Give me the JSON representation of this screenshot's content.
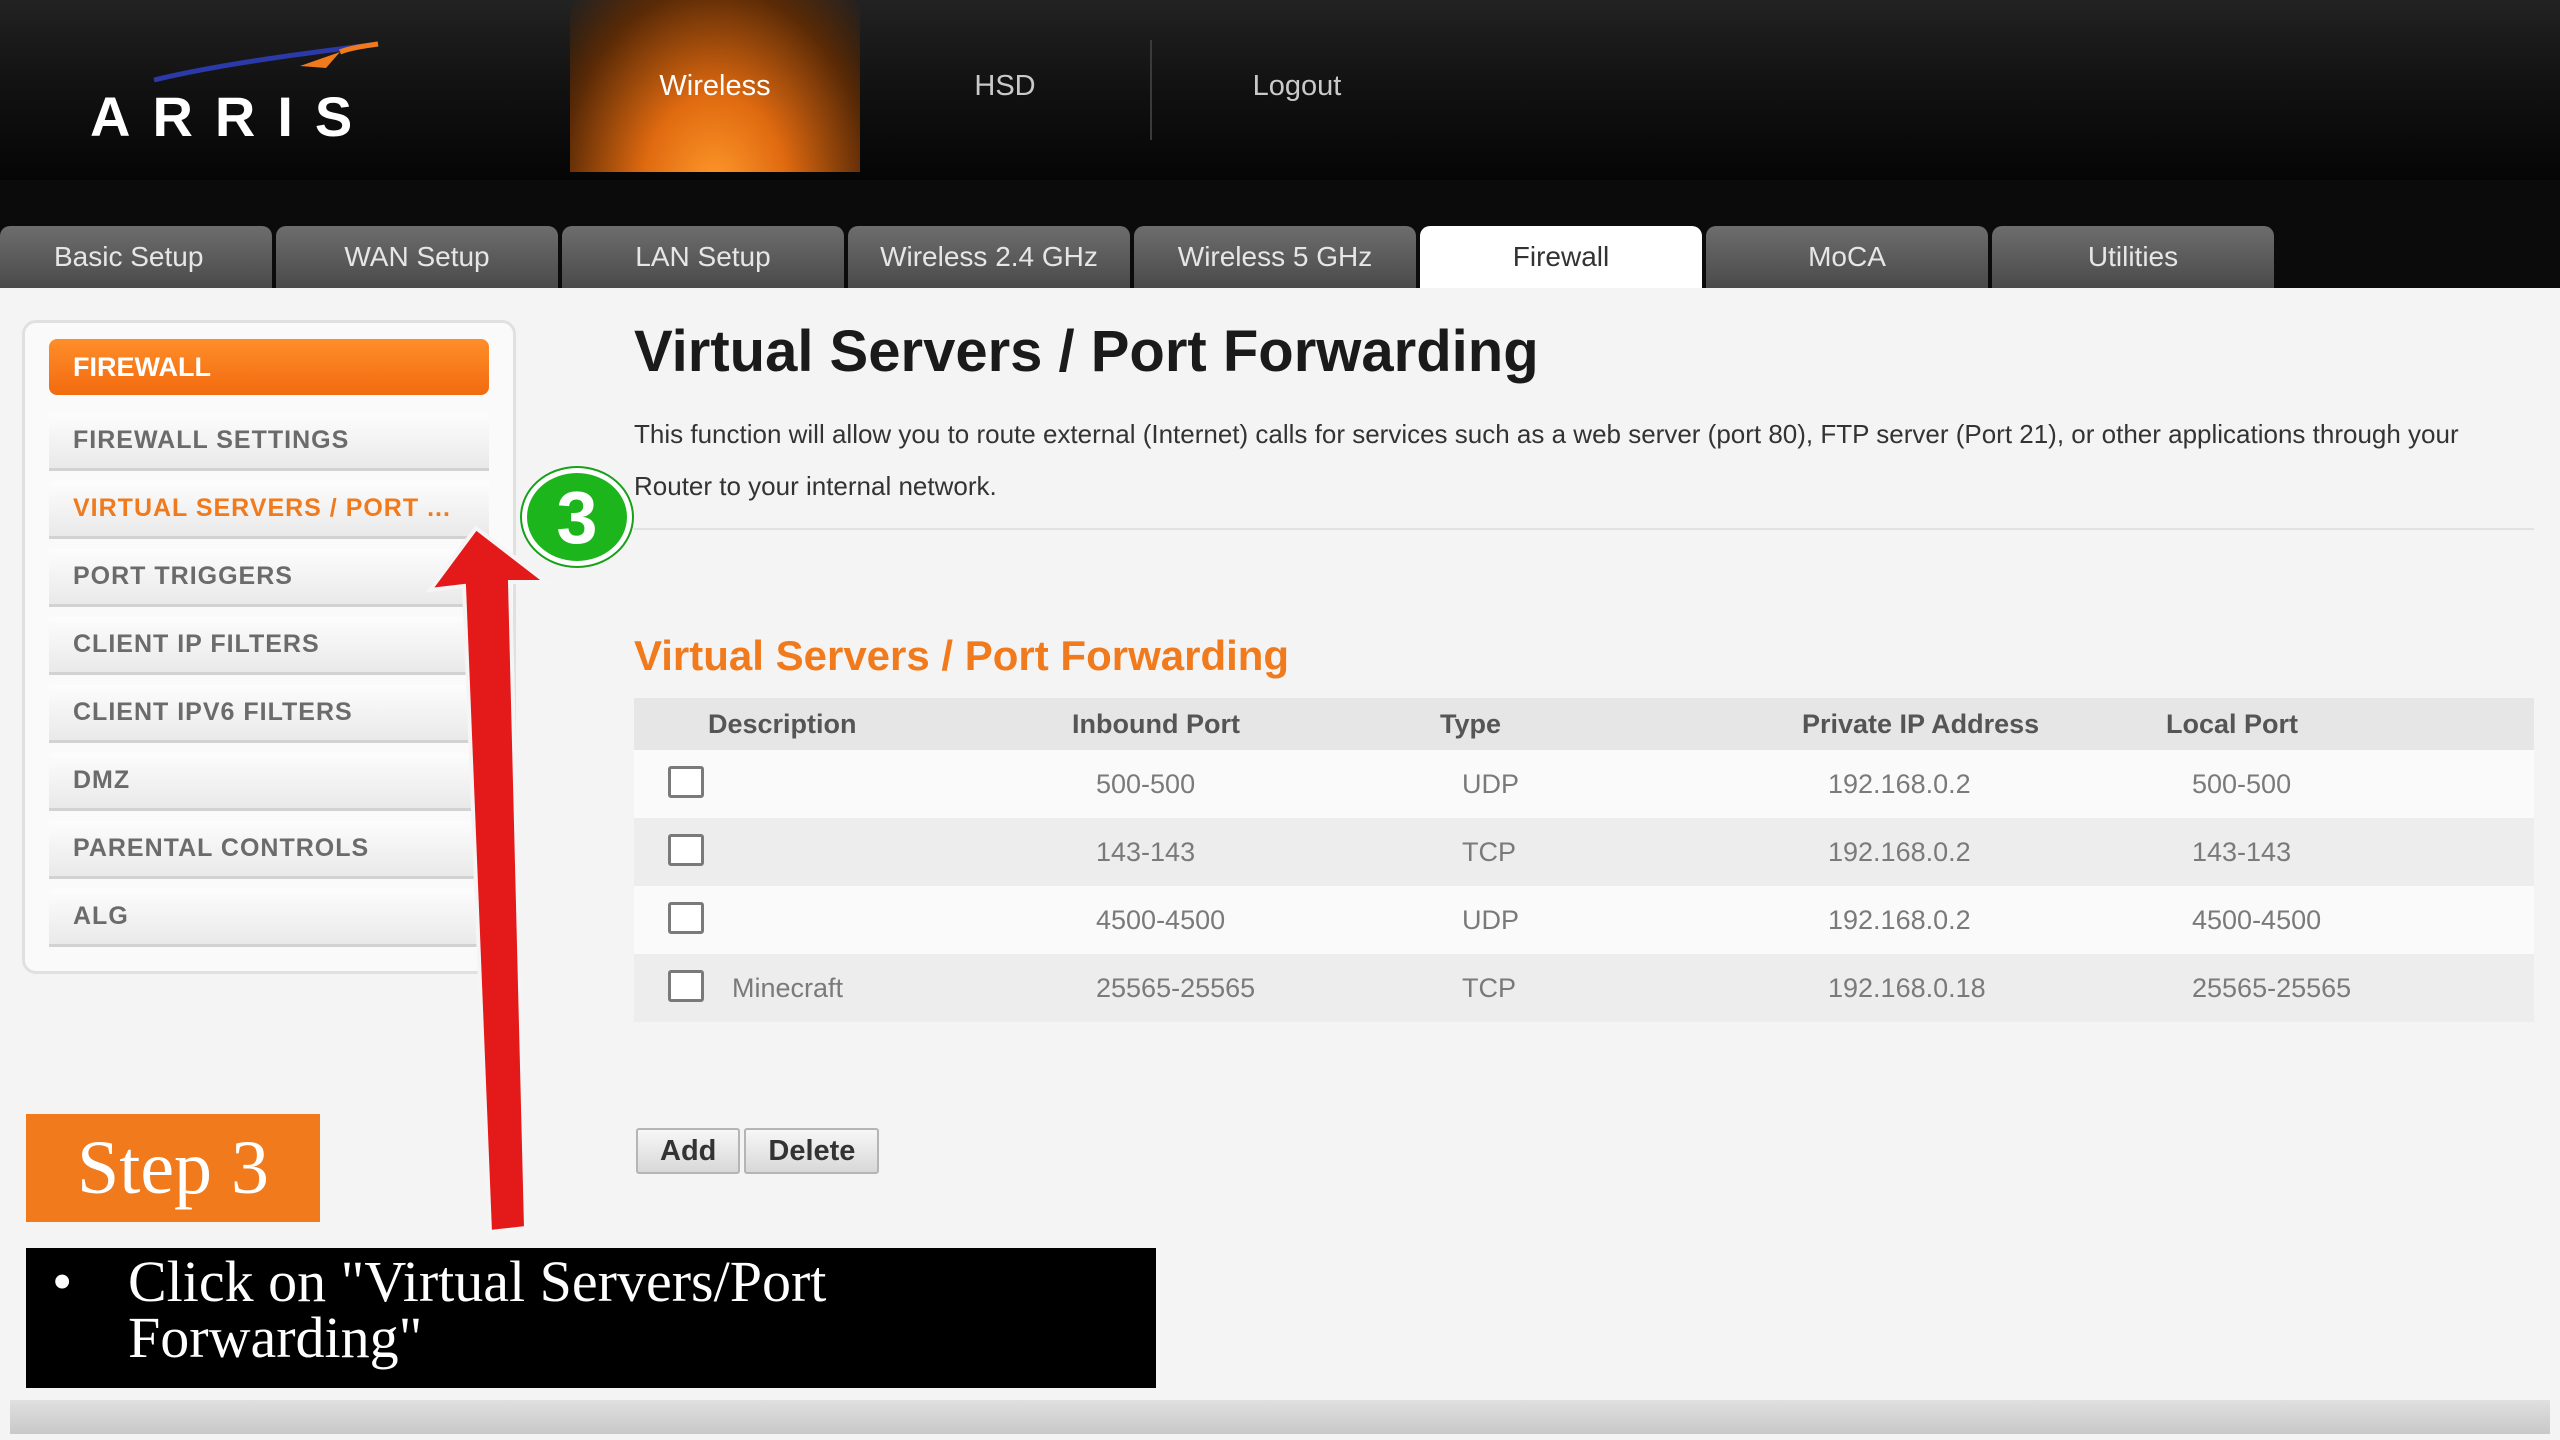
{
  "brand": {
    "name": "ARRIS"
  },
  "top_nav": [
    {
      "label": "Wireless",
      "active": true
    },
    {
      "label": "HSD",
      "active": false
    },
    {
      "label": "Logout",
      "active": false
    }
  ],
  "tabs": [
    {
      "label": "Basic Setup",
      "active": false
    },
    {
      "label": "WAN Setup",
      "active": false
    },
    {
      "label": "LAN Setup",
      "active": false
    },
    {
      "label": "Wireless 2.4 GHz",
      "active": false
    },
    {
      "label": "Wireless 5 GHz",
      "active": false
    },
    {
      "label": "Firewall",
      "active": true
    },
    {
      "label": "MoCA",
      "active": false
    },
    {
      "label": "Utilities",
      "active": false
    }
  ],
  "sidebar": {
    "header": "FIREWALL",
    "items": [
      {
        "label": "FIREWALL SETTINGS",
        "active": false
      },
      {
        "label": "VIRTUAL SERVERS / PORT ...",
        "active": true
      },
      {
        "label": "PORT TRIGGERS",
        "active": false
      },
      {
        "label": "CLIENT IP FILTERS",
        "active": false
      },
      {
        "label": "CLIENT IPV6 FILTERS",
        "active": false
      },
      {
        "label": "DMZ",
        "active": false
      },
      {
        "label": "PARENTAL CONTROLS",
        "active": false
      },
      {
        "label": "ALG",
        "active": false
      }
    ]
  },
  "main": {
    "title": "Virtual Servers / Port Forwarding",
    "description": "This function will allow you to route external (Internet) calls for services such as a web server (port 80), FTP server (Port 21), or other applications through your Router to your internal network.",
    "section_title": "Virtual Servers / Port Forwarding",
    "table": {
      "headers": [
        "Description",
        "Inbound Port",
        "Type",
        "Private IP Address",
        "Local Port"
      ],
      "rows": [
        {
          "description": "",
          "inbound_port": "500-500",
          "type": "UDP",
          "private_ip": "192.168.0.2",
          "local_port": "500-500"
        },
        {
          "description": "",
          "inbound_port": "143-143",
          "type": "TCP",
          "private_ip": "192.168.0.2",
          "local_port": "143-143"
        },
        {
          "description": "",
          "inbound_port": "4500-4500",
          "type": "UDP",
          "private_ip": "192.168.0.2",
          "local_port": "4500-4500"
        },
        {
          "description": "Minecraft",
          "inbound_port": "25565-25565",
          "type": "TCP",
          "private_ip": "192.168.0.18",
          "local_port": "25565-25565"
        }
      ]
    },
    "buttons": {
      "add": "Add",
      "delete": "Delete"
    }
  },
  "annotations": {
    "step_number": "3",
    "step_label": "Step 3",
    "bullet": "•",
    "caption": "Click on \"Virtual Servers/Port Forwarding\"",
    "arrow_color": "#e41a1a",
    "badge_color": "#1cb51c"
  },
  "colors": {
    "accent_orange": "#f07a1c",
    "header_black": "#111111",
    "tab_gray": "#5a5a5a"
  }
}
